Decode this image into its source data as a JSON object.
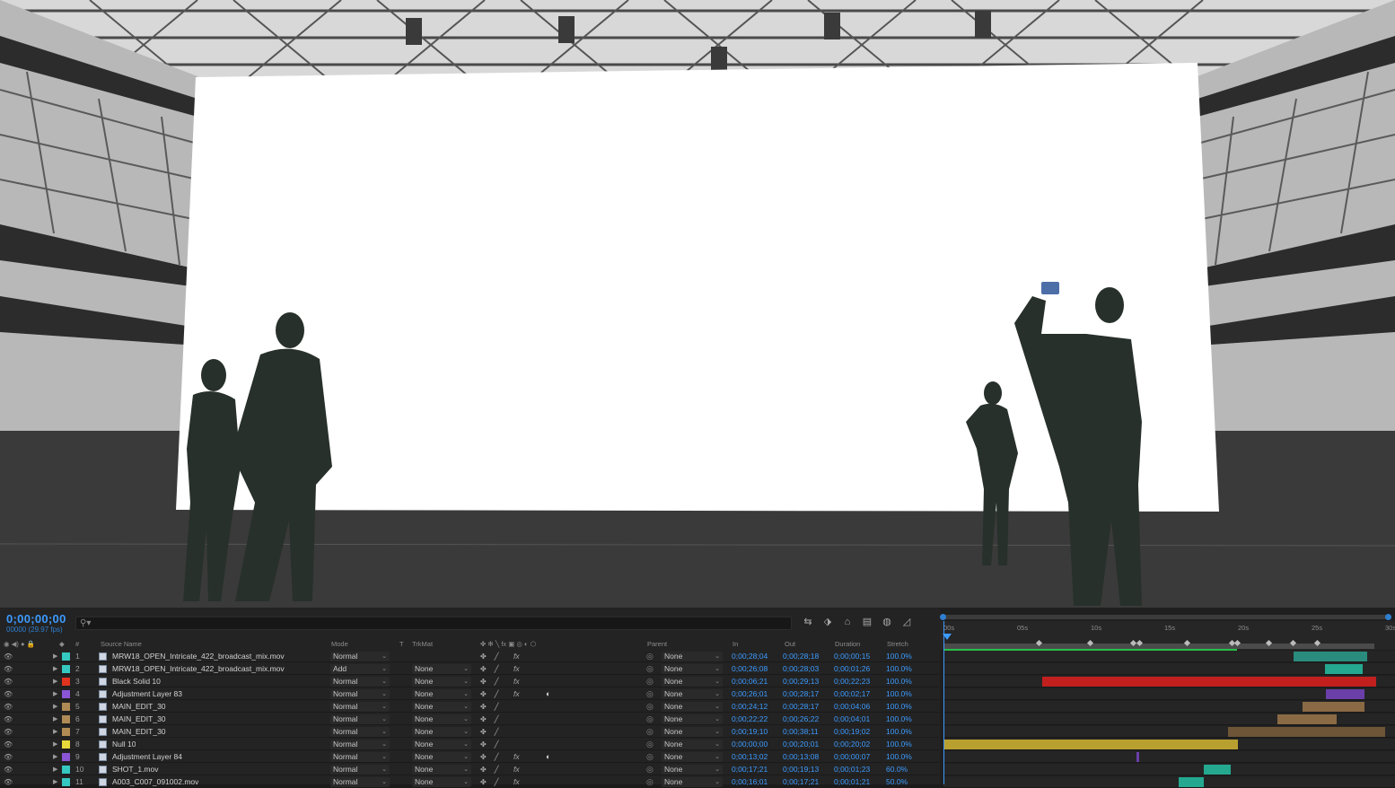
{
  "composition": {
    "timecode": "0;00;00;00",
    "fps": "00000 (29.97 fps)"
  },
  "toolbar": {
    "icons": [
      "comp-mini-flowchart-icon",
      "draft-3d-icon",
      "shy-layers-icon",
      "frame-blending-icon",
      "motion-blur-icon",
      "graph-editor-icon"
    ]
  },
  "columns": {
    "num": "#",
    "source_name": "Source Name",
    "mode": "Mode",
    "t": "T",
    "trkmat": "TrkMat",
    "parent": "Parent",
    "in": "In",
    "out": "Out",
    "duration": "Duration",
    "stretch": "Stretch"
  },
  "ruler": {
    "ticks": [
      "00s",
      "05s",
      "10s",
      "15s",
      "20s",
      "25s",
      "30s"
    ]
  },
  "layers": [
    {
      "num": "1",
      "name": "MRW18_OPEN_Intricate_422_broadcast_mix.mov",
      "color": "#35c8c0",
      "mode": "Normal",
      "trkmat": "",
      "fx": true,
      "adj": false,
      "parent": "None",
      "in": "0;00;28;04",
      "out": "0;00;28;18",
      "duration": "0;00;00;15",
      "stretch": "100.0%"
    },
    {
      "num": "2",
      "name": "MRW18_OPEN_Intricate_422_broadcast_mix.mov",
      "color": "#35c8c0",
      "mode": "Add",
      "trkmat": "None",
      "fx": true,
      "adj": false,
      "parent": "None",
      "in": "0;00;26;08",
      "out": "0;00;28;03",
      "duration": "0;00;01;26",
      "stretch": "100.0%"
    },
    {
      "num": "3",
      "name": "Black Solid 10",
      "color": "#e0341f",
      "mode": "Normal",
      "trkmat": "None",
      "fx": true,
      "adj": false,
      "parent": "None",
      "in": "0;00;06;21",
      "out": "0;00;29;13",
      "duration": "0;00;22;23",
      "stretch": "100.0%"
    },
    {
      "num": "4",
      "name": "Adjustment Layer 83",
      "color": "#8a55d6",
      "mode": "Normal",
      "trkmat": "None",
      "fx": true,
      "adj": true,
      "parent": "None",
      "in": "0;00;26;01",
      "out": "0;00;28;17",
      "duration": "0;00;02;17",
      "stretch": "100.0%"
    },
    {
      "num": "5",
      "name": "MAIN_EDIT_30",
      "color": "#b08a55",
      "mode": "Normal",
      "trkmat": "None",
      "fx": false,
      "adj": false,
      "parent": "None",
      "in": "0;00;24;12",
      "out": "0;00;28;17",
      "duration": "0;00;04;06",
      "stretch": "100.0%"
    },
    {
      "num": "6",
      "name": "MAIN_EDIT_30",
      "color": "#b08a55",
      "mode": "Normal",
      "trkmat": "None",
      "fx": false,
      "adj": false,
      "parent": "None",
      "in": "0;00;22;22",
      "out": "0;00;26;22",
      "duration": "0;00;04;01",
      "stretch": "100.0%"
    },
    {
      "num": "7",
      "name": "MAIN_EDIT_30",
      "color": "#b08a55",
      "mode": "Normal",
      "trkmat": "None",
      "fx": false,
      "adj": false,
      "parent": "None",
      "in": "0;00;19;10",
      "out": "0;00;38;11",
      "duration": "0;00;19;02",
      "stretch": "100.0%"
    },
    {
      "num": "8",
      "name": "Null 10",
      "color": "#e8d83a",
      "mode": "Normal",
      "trkmat": "None",
      "fx": false,
      "adj": false,
      "parent": "None",
      "in": "0;00;00;00",
      "out": "0;00;20;01",
      "duration": "0;00;20;02",
      "stretch": "100.0%"
    },
    {
      "num": "9",
      "name": "Adjustment Layer 84",
      "color": "#8a55d6",
      "mode": "Normal",
      "trkmat": "None",
      "fx": true,
      "adj": true,
      "parent": "None",
      "in": "0;00;13;02",
      "out": "0;00;13;08",
      "duration": "0;00;00;07",
      "stretch": "100.0%"
    },
    {
      "num": "10",
      "name": "SHOT_1.mov",
      "color": "#35c8c0",
      "mode": "Normal",
      "trkmat": "None",
      "fx": true,
      "adj": false,
      "parent": "None",
      "in": "0;00;17;21",
      "out": "0;00;19;13",
      "duration": "0;00;01;23",
      "stretch": "60.0%"
    },
    {
      "num": "11",
      "name": "A003_C007_091002.mov",
      "color": "#35c8c0",
      "mode": "Normal",
      "trkmat": "None",
      "fx": true,
      "adj": false,
      "parent": "None",
      "in": "0;00;16;01",
      "out": "0;00;17;21",
      "duration": "0;00;01;21",
      "stretch": "50.0%"
    }
  ],
  "timeline_bars": [
    {
      "color": "#2a8c7c",
      "start": 23.8,
      "end": 28.8
    },
    {
      "color": "#24a890",
      "start": 25.9,
      "end": 28.5
    },
    {
      "color": "#c21f1f",
      "start": 6.7,
      "end": 29.4
    },
    {
      "color": "#6a3fa8",
      "start": 26.0,
      "end": 28.6
    },
    {
      "color": "#8a6a45",
      "start": 24.4,
      "end": 28.6
    },
    {
      "color": "#8a6a45",
      "start": 22.7,
      "end": 26.7
    },
    {
      "color": "#6e5538",
      "start": 19.3,
      "end": 30.0
    },
    {
      "color": "#b8a030",
      "start": 0.0,
      "end": 20.0
    },
    {
      "color": "#6a3fa8",
      "start": 13.1,
      "end": 13.3
    },
    {
      "color": "#24a890",
      "start": 17.7,
      "end": 19.5
    },
    {
      "color": "#24a890",
      "start": 16.0,
      "end": 17.7
    }
  ]
}
